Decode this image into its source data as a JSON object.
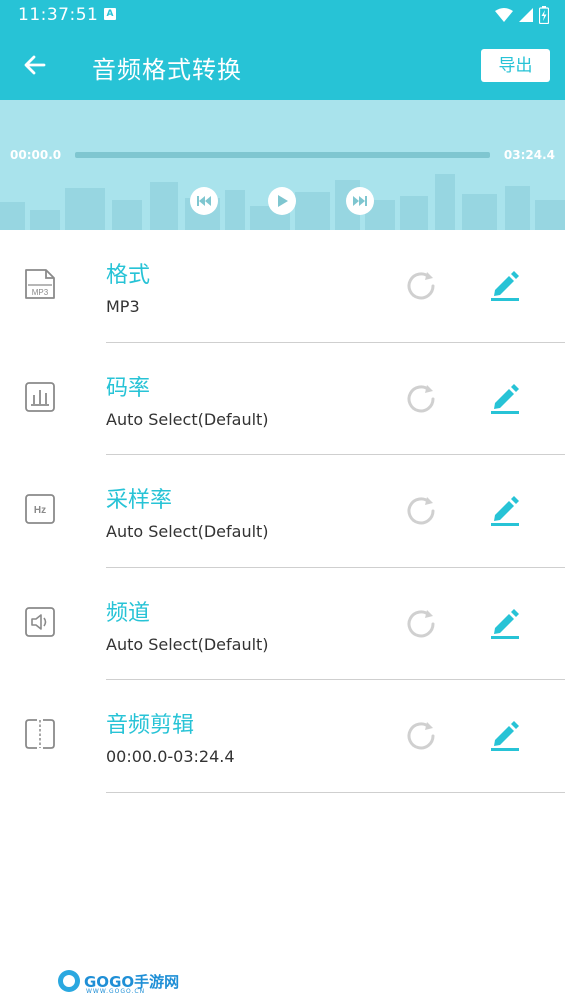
{
  "status_bar": {
    "time": "11:37:51",
    "notification_icon": "A",
    "icons": [
      "wifi-icon",
      "signal-icon",
      "battery-icon"
    ]
  },
  "app_bar": {
    "title": "音频格式转换",
    "back_icon": "arrow-left-icon",
    "export_label": "导出"
  },
  "player": {
    "current_time": "00:00.0",
    "total_time": "03:24.4",
    "progress": 0,
    "controls": [
      "previous-icon",
      "play-icon",
      "next-icon"
    ]
  },
  "settings": [
    {
      "label": "格式",
      "value": "MP3",
      "icon": "mp3-file-icon"
    },
    {
      "label": "码率",
      "value": "Auto Select(Default)",
      "icon": "bitrate-chart-icon"
    },
    {
      "label": "采样率",
      "value": "Auto Select(Default)",
      "icon": "hz-icon"
    },
    {
      "label": "频道",
      "value": "Auto Select(Default)",
      "icon": "speaker-icon"
    },
    {
      "label": "音频剪辑",
      "value": "00:00.0-03:24.4",
      "icon": "trim-icon"
    }
  ],
  "icon_badges": {
    "mp3": "MP3",
    "hz": "Hz"
  },
  "watermark": {
    "text": "GOGO手游网",
    "sub": "WWW.GOGO.CN"
  },
  "colors": {
    "accent": "#27c3d6",
    "player_bg": "#a9e3ec",
    "text_dark": "#333333",
    "divider": "#cfcfcf"
  }
}
